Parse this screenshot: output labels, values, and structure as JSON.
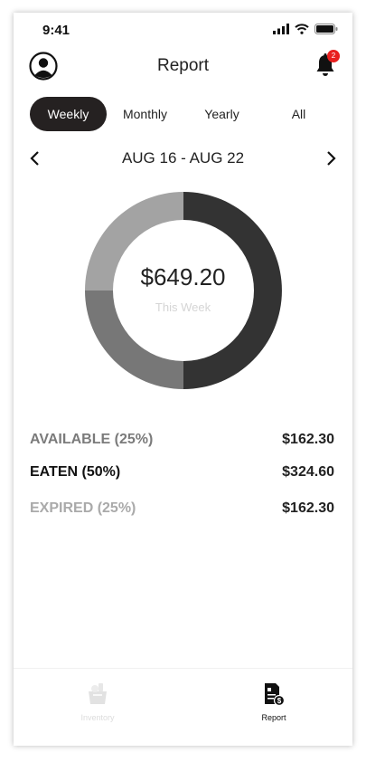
{
  "status_bar": {
    "time": "9:41"
  },
  "header": {
    "title": "Report",
    "notification_count": "2"
  },
  "tabs": [
    {
      "label": "Weekly",
      "active": true
    },
    {
      "label": "Monthly",
      "active": false
    },
    {
      "label": "Yearly",
      "active": false
    },
    {
      "label": "All",
      "active": false
    }
  ],
  "date_range": {
    "label": "AUG 16 - AUG 22"
  },
  "summary": {
    "total": "$649.20",
    "subtitle": "This Week"
  },
  "chart_data": {
    "type": "pie",
    "categories": [
      "Eaten",
      "Expired",
      "Available"
    ],
    "values": [
      50,
      25,
      25
    ],
    "colors": [
      "#333333",
      "#777777",
      "#a3a3a3"
    ]
  },
  "legend": [
    {
      "label": "AVAILABLE (25%)",
      "value": "$162.30",
      "color": "#7b7b7b"
    },
    {
      "label": "EATEN (50%)",
      "value": "$324.60",
      "color": "#111111"
    },
    {
      "label": "EXPIRED (25%)",
      "value": "$162.30",
      "color": "#aaaaaa"
    }
  ],
  "bottom_nav": [
    {
      "label": "Inventory",
      "icon": "grocery-bag-icon",
      "active": false
    },
    {
      "label": "Report",
      "icon": "report-document-icon",
      "active": true
    }
  ]
}
